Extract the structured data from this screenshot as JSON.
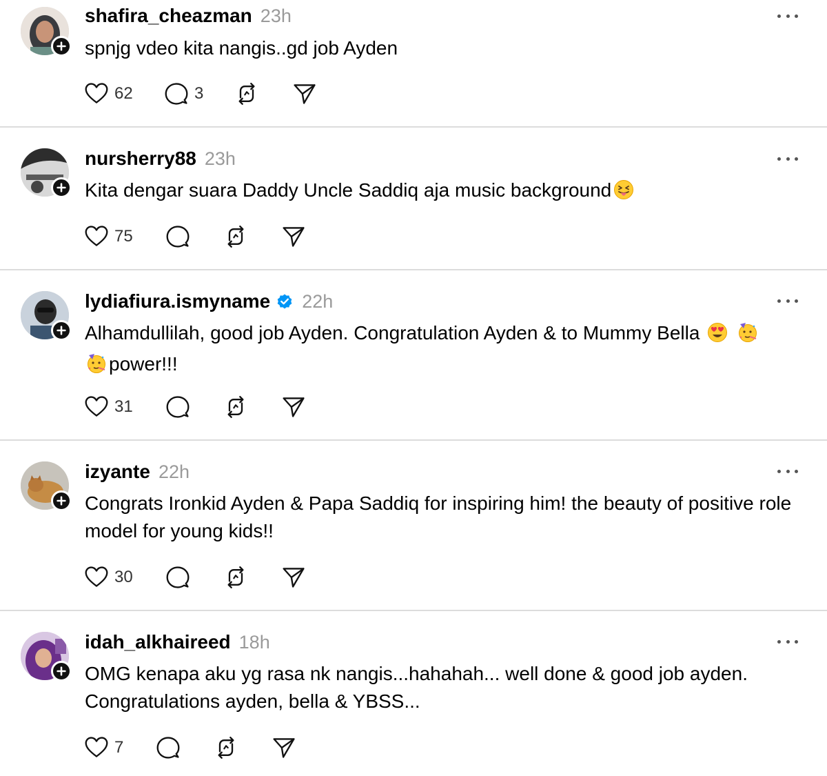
{
  "colors": {
    "divider": "#dcdcdc",
    "timestamp": "#9a9a9a",
    "verified": "#0095f6",
    "badge": "#111111"
  },
  "icons": {
    "like": "heart-icon",
    "reply": "comment-icon",
    "repost": "repost-icon",
    "share": "send-icon",
    "more": "more-options-icon",
    "follow": "plus-icon",
    "verified": "verified-badge-icon"
  },
  "posts": [
    {
      "username": "shafira_cheazman",
      "time": "23h",
      "verified": false,
      "text": "spnjg vdeo kita nangis..gd job Ayden",
      "likes": "62",
      "replies": "3"
    },
    {
      "username": "nursherry88",
      "time": "23h",
      "verified": false,
      "text": "Kita dengar suara Daddy Uncle Saddiq aja music background",
      "emoji_after": "face-with-tongue",
      "likes": "75",
      "replies": ""
    },
    {
      "username": "lydiafiura.ismyname",
      "time": "22h",
      "verified": true,
      "text_line1": "Alhamdullilah, good job Ayden. Congratulation Ayden & to Mummy Bella",
      "text_line2": "power!!!",
      "emojis": [
        "smiling-face-with-heart-eyes",
        "partying-face",
        "partying-face"
      ],
      "likes": "31",
      "replies": ""
    },
    {
      "username": "izyante",
      "time": "22h",
      "verified": false,
      "text": "Congrats Ironkid Ayden & Papa Saddiq for inspiring him! the beauty of positive role model for young kids!!",
      "likes": "30",
      "replies": ""
    },
    {
      "username": "idah_alkhaireed",
      "time": "18h",
      "verified": false,
      "text": "OMG kenapa aku yg rasa nk nangis...hahahah... well done & good job ayden. Congratulations ayden, bella & YBSS...",
      "likes": "7",
      "replies": ""
    }
  ]
}
